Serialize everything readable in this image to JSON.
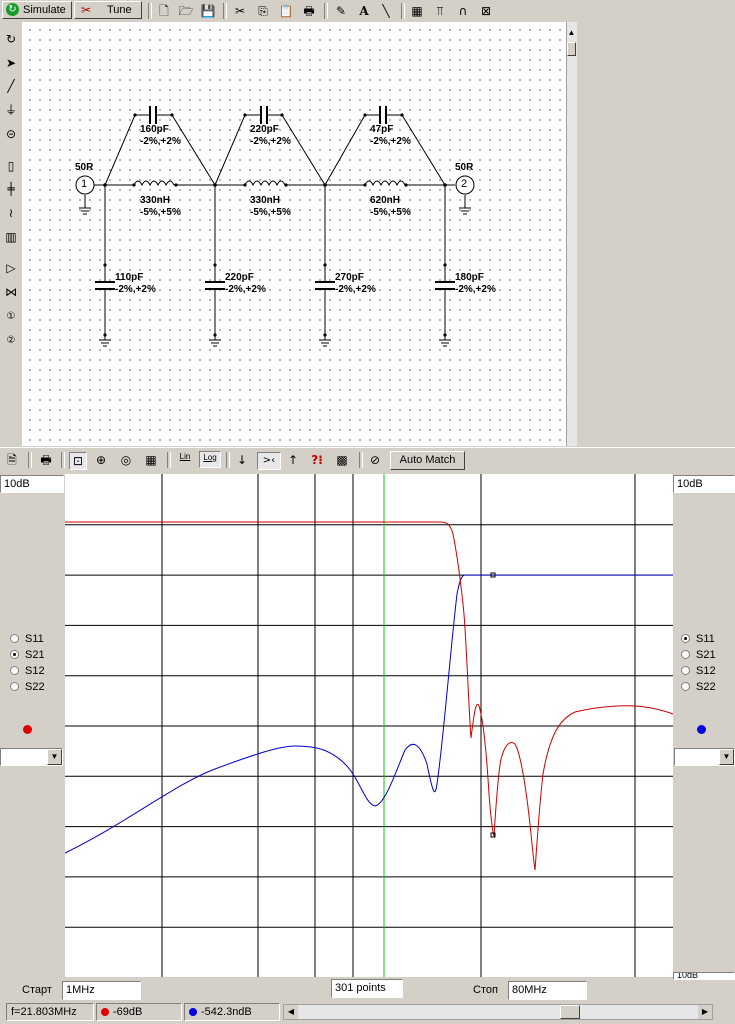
{
  "toolbar": {
    "simulate_label": "Simulate",
    "tune_label": "Tune"
  },
  "schematic": {
    "ports": [
      {
        "number": "1",
        "impedance": "50R"
      },
      {
        "number": "2",
        "impedance": "50R"
      }
    ],
    "series_capacitors": [
      {
        "value": "160pF",
        "tolerance": "-2%,+2%"
      },
      {
        "value": "220pF",
        "tolerance": "-2%,+2%"
      },
      {
        "value": "47pF",
        "tolerance": "-2%,+2%"
      }
    ],
    "inductors": [
      {
        "value": "330nH",
        "tolerance": "-5%,+5%"
      },
      {
        "value": "330nH",
        "tolerance": "-5%,+5%"
      },
      {
        "value": "620nH",
        "tolerance": "-5%,+5%"
      }
    ],
    "shunt_capacitors": [
      {
        "value": "110pF",
        "tolerance": "-2%,+2%"
      },
      {
        "value": "220pF",
        "tolerance": "-2%,+2%"
      },
      {
        "value": "270pF",
        "tolerance": "-2%,+2%"
      },
      {
        "value": "180pF",
        "tolerance": "-2%,+2%"
      }
    ]
  },
  "graph_toolbar": {
    "lin_label": "Lin",
    "log_label": "Log",
    "auto_match_label": "Auto Match"
  },
  "graph": {
    "left_scale": "10dB",
    "right_scale": "10dB",
    "right_bottom_scale": "10dB",
    "left_params": [
      "S11",
      "S21",
      "S12",
      "S22"
    ],
    "left_selected": "S21",
    "left_color": "#ff0000",
    "right_params": [
      "S11",
      "S21",
      "S12",
      "S22"
    ],
    "right_selected": "S11",
    "right_color": "#0000ff",
    "marker_color": "#00c000"
  },
  "sweep": {
    "start_label": "Старт",
    "start_value": "1MHz",
    "points": "301 points",
    "stop_label": "Стоп",
    "stop_value": "80MHz"
  },
  "status": {
    "frequency": "f=21.803MHz",
    "red_readout": "-69dB",
    "blue_readout": "-542.3ndB"
  }
}
